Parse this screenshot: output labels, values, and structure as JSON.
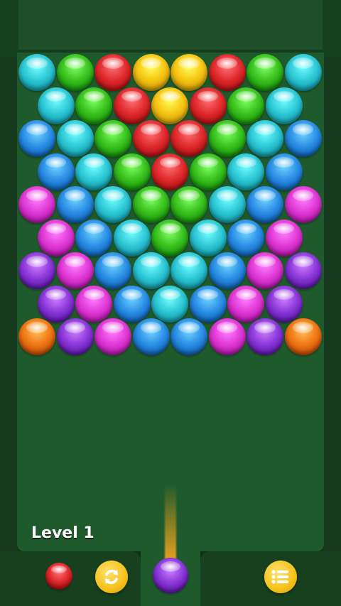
{
  "level": {
    "label": "Level 1"
  },
  "colors": {
    "cyan": "#2ec8d6",
    "green": "#3ac21e",
    "red": "#e02a2e",
    "yellow": "#f7c514",
    "blue": "#2b8fe6",
    "magenta": "#e03ad6",
    "purple": "#8a38d8",
    "orange": "#f07814",
    "board": "#1f5a2c",
    "button_gold": "#f5c21b"
  },
  "grid": {
    "rows": [
      [
        "cyan",
        "green",
        "red",
        "yellow",
        "yellow",
        "red",
        "green",
        "cyan"
      ],
      [
        "cyan",
        "green",
        "red",
        "yellow",
        "red",
        "green",
        "cyan"
      ],
      [
        "blue",
        "cyan",
        "green",
        "red",
        "red",
        "green",
        "cyan",
        "blue"
      ],
      [
        "blue",
        "cyan",
        "green",
        "red",
        "green",
        "cyan",
        "blue"
      ],
      [
        "magenta",
        "blue",
        "cyan",
        "green",
        "green",
        "cyan",
        "blue",
        "magenta"
      ],
      [
        "magenta",
        "blue",
        "cyan",
        "green",
        "cyan",
        "blue",
        "magenta"
      ],
      [
        "purple",
        "magenta",
        "blue",
        "cyan",
        "cyan",
        "blue",
        "magenta",
        "purple"
      ],
      [
        "purple",
        "magenta",
        "blue",
        "cyan",
        "blue",
        "magenta",
        "purple"
      ],
      [
        "orange",
        "purple",
        "magenta",
        "blue",
        "blue",
        "magenta",
        "purple",
        "orange"
      ]
    ]
  },
  "shooter": {
    "current_color": "purple",
    "next_color": "red"
  },
  "buttons": {
    "swap_icon": "refresh-icon",
    "menu_icon": "list-menu-icon"
  }
}
